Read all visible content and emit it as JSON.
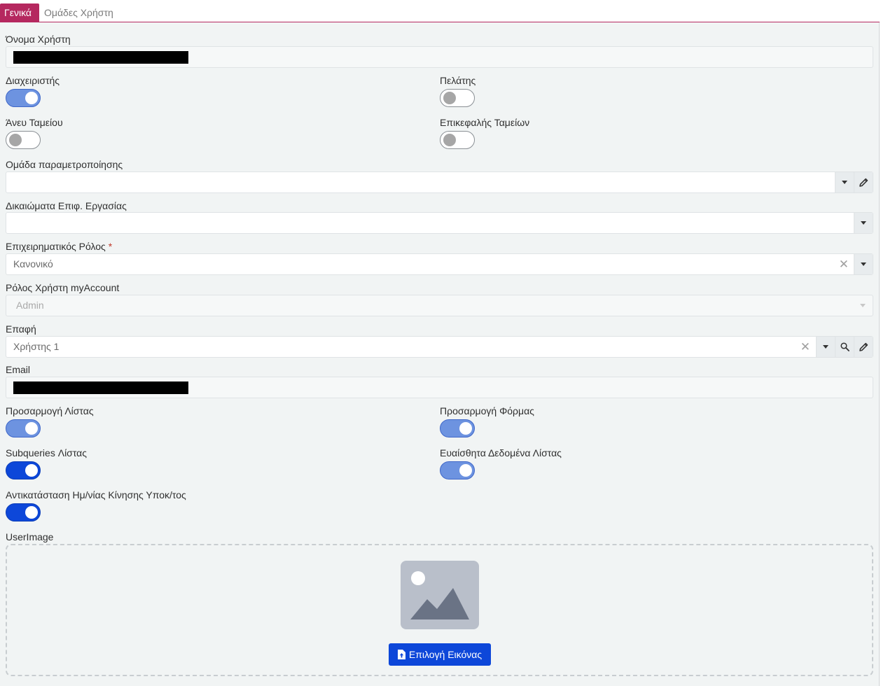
{
  "tabs": [
    {
      "label": "Γενικά",
      "active": true
    },
    {
      "label": "Ομάδες Χρήστη",
      "active": false
    }
  ],
  "fields": {
    "username": {
      "label": "Όνομα Χρήστη",
      "value_redacted": true
    },
    "admin": {
      "label": "Διαχειριστής",
      "on": true
    },
    "customer": {
      "label": "Πελάτης",
      "on": false
    },
    "no_cashier": {
      "label": "Άνευ Ταμείου",
      "on": false
    },
    "head_cashiers": {
      "label": "Επικεφαλής Ταμείων",
      "on": false
    },
    "param_group": {
      "label": "Ομάδα παραμετροποίησης",
      "value": ""
    },
    "workspace_rights": {
      "label": "Δικαιώματα Επιφ. Εργασίας",
      "value": ""
    },
    "business_role": {
      "label": "Επιχειρηματικός Ρόλος",
      "required_mark": "*",
      "value": "Κανονικό"
    },
    "myaccount_role": {
      "label": "Ρόλος Χρήστη myAccount",
      "value": "Admin"
    },
    "contact": {
      "label": "Επαφή",
      "value": "Χρήστης 1"
    },
    "email": {
      "label": "Email",
      "value_redacted": true
    },
    "list_customization": {
      "label": "Προσαρμογή Λίστας",
      "on": true
    },
    "form_customization": {
      "label": "Προσαρμογή Φόρμας",
      "on": true
    },
    "list_subqueries": {
      "label": "Subqueries Λίστας",
      "on": true
    },
    "sensitive_list_data": {
      "label": "Ευαίσθητα Δεδομένα Λίστας",
      "on": true
    },
    "replace_branch_date": {
      "label": "Αντικατάσταση Ημ/νίας Κίνησης Υποκ/τος",
      "on": true
    },
    "user_image": {
      "label": "UserImage",
      "button_label": "Επιλογή Εικόνας"
    }
  },
  "colors": {
    "tab_accent": "#b5285f",
    "primary": "#0d47d9",
    "toggle_light": "#6d93e0",
    "panel_bg": "#f1f4f4"
  },
  "icons": [
    "caret-down-icon",
    "pencil-icon",
    "search-icon",
    "clear-icon",
    "image-placeholder-icon",
    "upload-icon"
  ]
}
